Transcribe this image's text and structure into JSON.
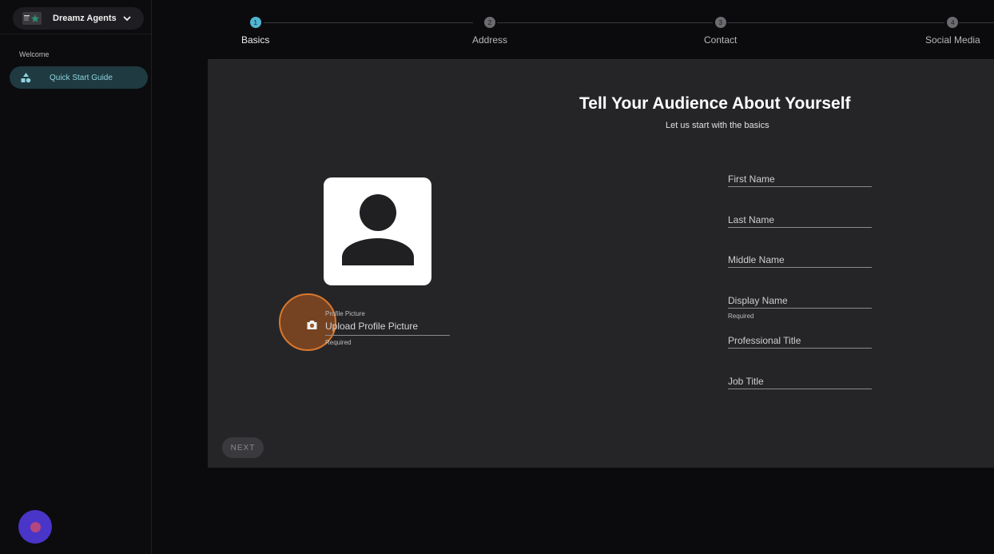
{
  "sidebar": {
    "account_name": "Dreamz Agents",
    "section_label": "Welcome",
    "nav_items": [
      {
        "label": "Quick Start Guide",
        "icon": "shapes-icon",
        "active": true
      }
    ],
    "fab_icon": "assistant-icon"
  },
  "stepper": {
    "steps": [
      {
        "number": "1",
        "label": "Basics",
        "active": true
      },
      {
        "number": "2",
        "label": "Address",
        "active": false
      },
      {
        "number": "3",
        "label": "Contact",
        "active": false
      },
      {
        "number": "4",
        "label": "Social Media",
        "active": false
      }
    ]
  },
  "form": {
    "title": "Tell Your Audience About Yourself",
    "subtitle": "Let us start with the basics",
    "profile_picture": {
      "label": "Profile Picture",
      "placeholder": "Upload Profile Picture",
      "helper": "Required"
    },
    "fields": [
      {
        "placeholder": "First Name",
        "helper": ""
      },
      {
        "placeholder": "Last Name",
        "helper": ""
      },
      {
        "placeholder": "Middle Name",
        "helper": ""
      },
      {
        "placeholder": "Display Name",
        "helper": "Required"
      },
      {
        "placeholder": "Professional Title",
        "helper": ""
      },
      {
        "placeholder": "Job Title",
        "helper": ""
      }
    ],
    "next_label": "NEXT"
  },
  "colors": {
    "accent": "#4fb5d2",
    "highlight": "#d9782e",
    "nav_active_bg": "#1f3a40",
    "fab": "#4a35c9"
  }
}
